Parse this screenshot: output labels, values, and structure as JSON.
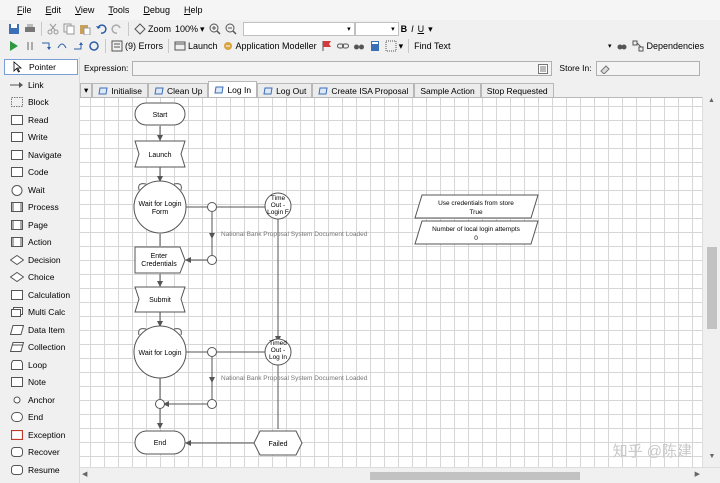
{
  "menu": [
    "File",
    "Edit",
    "View",
    "Tools",
    "Debug",
    "Help"
  ],
  "toolbar1": {
    "zoom_label": "Zoom",
    "zoom_value": "100%"
  },
  "toolbar2": {
    "errors": "(9) Errors",
    "launch": "Launch",
    "modeller": "Application Modeller",
    "find": "Find Text",
    "dependencies": "Dependencies"
  },
  "expression_label": "Expression:",
  "store_in_label": "Store In:",
  "tools": [
    "Pointer",
    "Link",
    "Block",
    "Read",
    "Write",
    "Navigate",
    "Code",
    "Wait",
    "Process",
    "Page",
    "Action",
    "Decision",
    "Choice",
    "Calculation",
    "Multi Calc",
    "Data Item",
    "Collection",
    "Loop",
    "Note",
    "Anchor",
    "End",
    "Exception",
    "Recover",
    "Resume"
  ],
  "tabs": [
    {
      "label": "Initialise",
      "active": false
    },
    {
      "label": "Clean Up",
      "active": false
    },
    {
      "label": "Log In",
      "active": true
    },
    {
      "label": "Log Out",
      "active": false
    },
    {
      "label": "Create ISA Proposal",
      "active": false
    },
    {
      "label": "Sample Action",
      "active": false
    },
    {
      "label": "Stop Requested",
      "active": false
    }
  ],
  "flow": {
    "start": "Start",
    "launch": "Launch",
    "wait1": "Wait for Login Form",
    "timeout1": "Time Out - Login F",
    "loaded1": "National Bank Proposal System Document Loaded",
    "enter": "Enter Credentials",
    "submit": "Submit",
    "wait2": "Wait for Login",
    "timeout2": "Timed Out - Log In",
    "loaded2": "National Bank Proposal System Document Loaded",
    "end": "End",
    "failed": "Failed",
    "data1_label": "Use credentials from store",
    "data1_value": "True",
    "data2_label": "Number of local login attempts",
    "data2_value": "0"
  },
  "watermark": "知乎 @陈建"
}
